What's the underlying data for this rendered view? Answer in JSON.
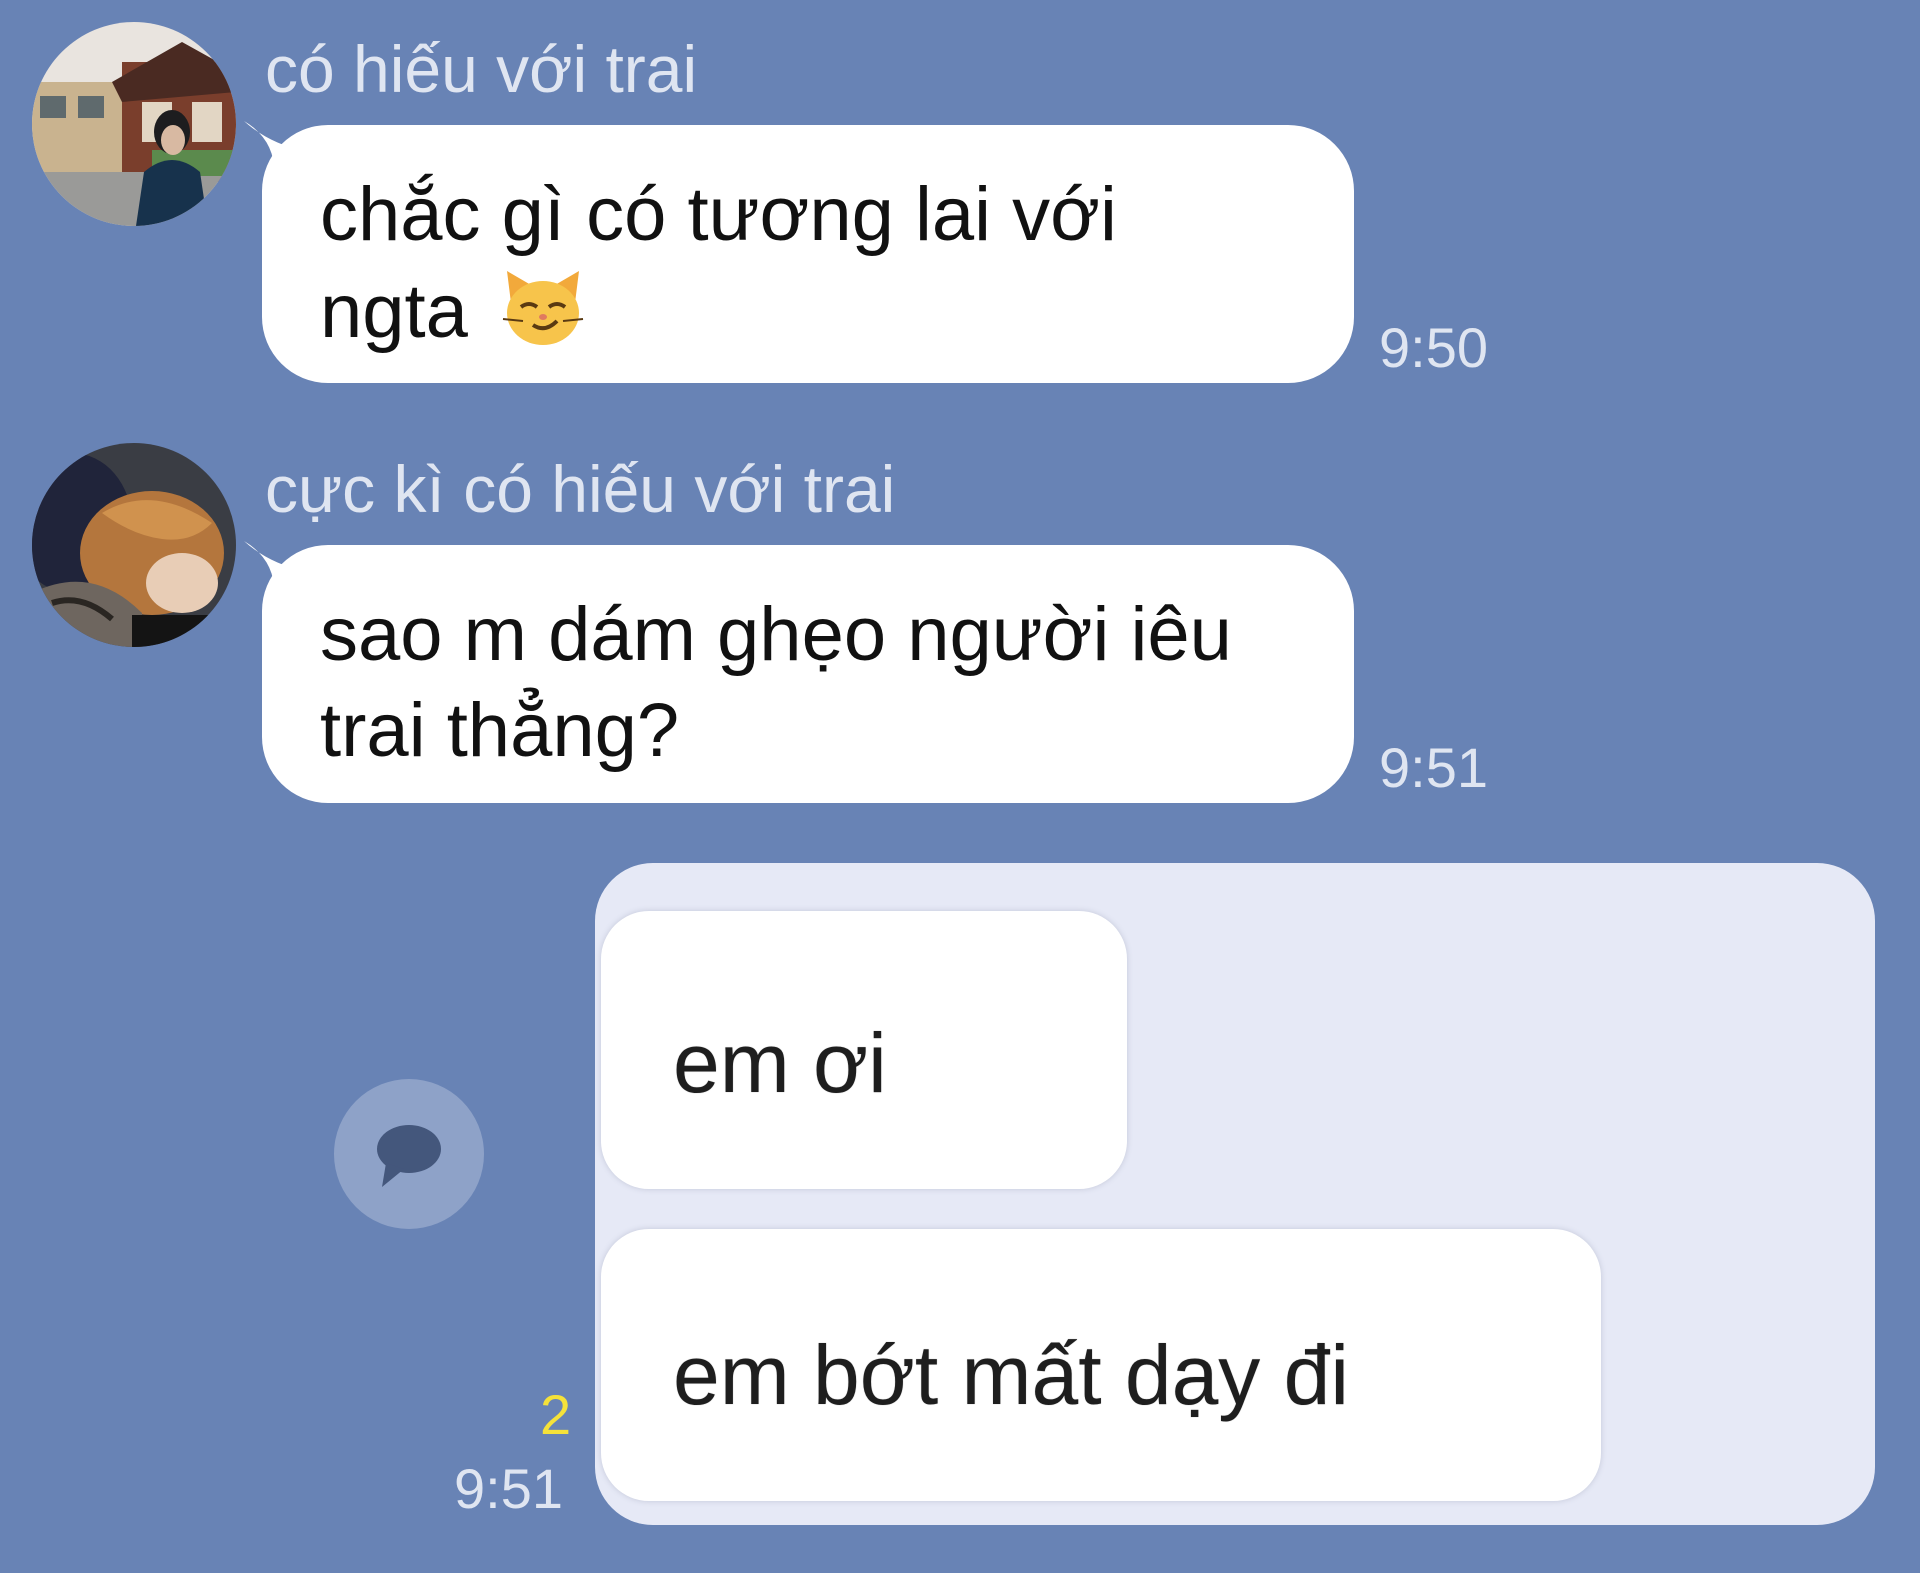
{
  "messages": [
    {
      "sender": "có hiếu với trai",
      "lines": [
        "chắc gì có tương lai với",
        "ngta"
      ],
      "emoji": "smirking-cat-face-icon",
      "time": "9:50"
    },
    {
      "sender": "cực kì có hiếu với trai",
      "lines": [
        "sao m dám ghẹo người iêu",
        "trai thẳng?"
      ],
      "time": "9:51"
    }
  ],
  "sent_image": {
    "read_count": "2",
    "time": "9:51",
    "bubbles": [
      "em ơi",
      "em bớt mất dạy đi"
    ]
  },
  "colors": {
    "background": "#6883b5",
    "bubble": "#ffffff",
    "meta_text": "#dfe5f1",
    "read_count": "#f5e23a",
    "image_card": "#e6e9f6"
  }
}
